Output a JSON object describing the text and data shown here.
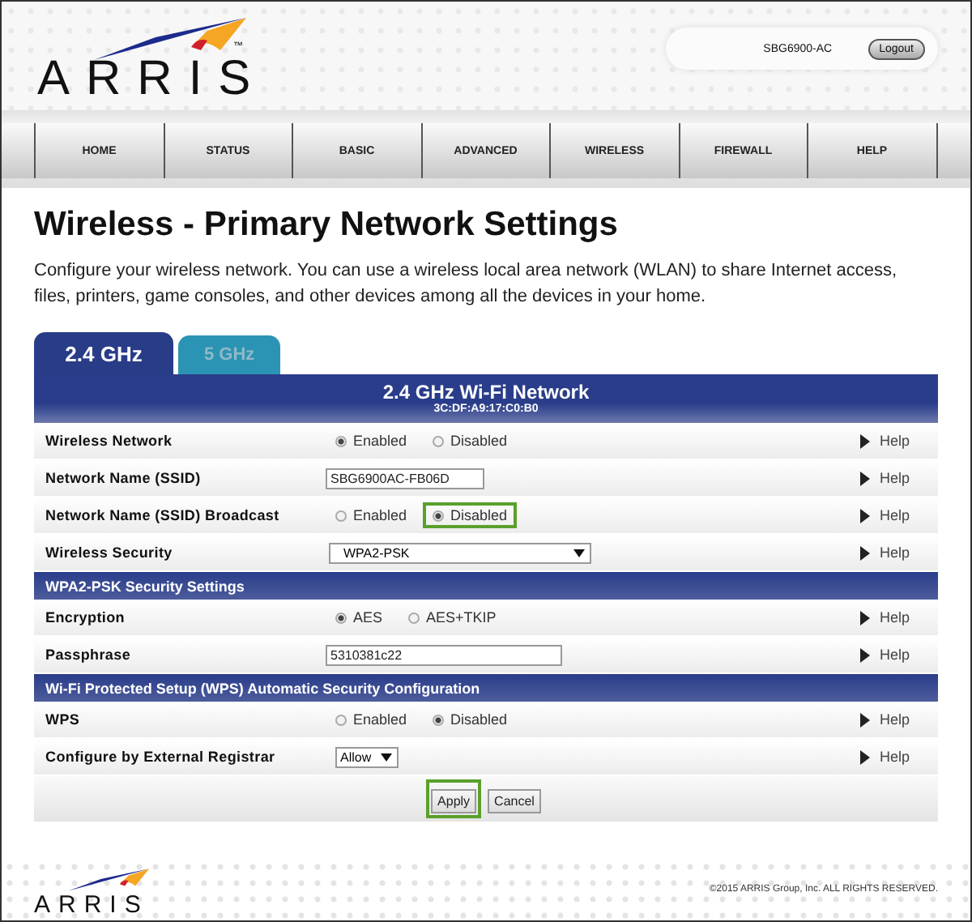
{
  "header": {
    "logo": "ARRIS",
    "trademark": "™",
    "model": "SBG6900-AC",
    "logout": "Logout"
  },
  "nav": [
    {
      "label": "HOME",
      "selected": false
    },
    {
      "label": "STATUS",
      "selected": false
    },
    {
      "label": "BASIC",
      "selected": false
    },
    {
      "label": "ADVANCED",
      "selected": false
    },
    {
      "label": "WIRELESS",
      "selected": false
    },
    {
      "label": "FIREWALL",
      "selected": false
    },
    {
      "label": "HELP",
      "selected": false
    }
  ],
  "page": {
    "title": "Wireless - Primary Network Settings",
    "intro": "Configure your wireless network. You can use a wireless local area network (WLAN) to share Internet access, files, printers, game consoles, and other devices among all the devices in your home."
  },
  "tabs": [
    {
      "label": "2.4 GHz",
      "selected": true
    },
    {
      "label": "5 GHz",
      "selected": false
    }
  ],
  "table": {
    "title": "2.4 GHz Wi-Fi Network",
    "mac": "3C:DF:A9:17:C0:B0",
    "rows": [
      {
        "kind": "radio",
        "label": "Wireless Network",
        "help": "Help",
        "options": [
          {
            "label": "Enabled",
            "selected": true,
            "highlighted": false
          },
          {
            "label": "Disabled",
            "selected": false,
            "highlighted": false
          }
        ]
      },
      {
        "kind": "text",
        "label": "Network Name (SSID)",
        "help": "Help",
        "value": "SBG6900AC-FB06D"
      },
      {
        "kind": "radio",
        "label": "Network Name (SSID) Broadcast",
        "help": "Help",
        "options": [
          {
            "label": "Enabled",
            "selected": false,
            "highlighted": false
          },
          {
            "label": "Disabled",
            "selected": true,
            "highlighted": true
          }
        ]
      },
      {
        "kind": "select",
        "label": "Wireless Security",
        "help": "Help",
        "value": "WPA2-PSK"
      },
      {
        "kind": "section",
        "label": "WPA2-PSK Security Settings"
      },
      {
        "kind": "radio",
        "label": "Encryption",
        "help": "Help",
        "options": [
          {
            "label": "AES",
            "selected": true,
            "highlighted": false
          },
          {
            "label": "AES+TKIP",
            "selected": false,
            "highlighted": false
          }
        ]
      },
      {
        "kind": "text",
        "label": "Passphrase",
        "help": "Help",
        "value": "5310381c22"
      },
      {
        "kind": "section",
        "label": "Wi-Fi Protected Setup (WPS) Automatic Security Configuration"
      },
      {
        "kind": "radio",
        "label": "WPS",
        "help": "Help",
        "options": [
          {
            "label": "Enabled",
            "selected": false,
            "highlighted": false
          },
          {
            "label": "Disabled",
            "selected": true,
            "highlighted": false
          }
        ]
      },
      {
        "kind": "select",
        "label": "Configure by External Registrar",
        "help": "Help",
        "value": "Allow"
      }
    ],
    "buttons": [
      {
        "label": "Apply",
        "highlighted": true
      },
      {
        "label": "Cancel",
        "highlighted": false
      }
    ]
  },
  "footer": {
    "logo": "ARRIS",
    "copyright": "©2015 ARRIS Group, Inc. ALL RIGHTS RESERVED."
  }
}
